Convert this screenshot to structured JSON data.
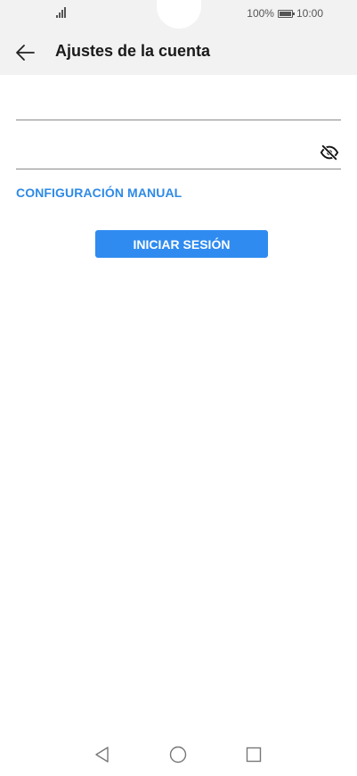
{
  "status_bar": {
    "battery_percent": "100%",
    "battery_level": 1.0,
    "time": "10:00",
    "icons": [
      "signal-icon",
      "battery-icon"
    ]
  },
  "app_bar": {
    "title": "Ajustes de la cuenta",
    "back_icon": "back-arrow-icon"
  },
  "form": {
    "email": {
      "value": "",
      "placeholder": ""
    },
    "password": {
      "value": "",
      "placeholder": "",
      "toggle_icon": "eye-off-icon"
    },
    "manual_setup_label": "CONFIGURACIÓN MANUAL",
    "login_label": "INICIAR SESIÓN"
  },
  "nav_bar": {
    "icons": [
      "nav-back-icon",
      "home-icon",
      "recents-icon"
    ]
  },
  "colors": {
    "accent": "#2e8ae6",
    "button": "#2f8bf0",
    "header_bg": "#f2f2f2"
  }
}
